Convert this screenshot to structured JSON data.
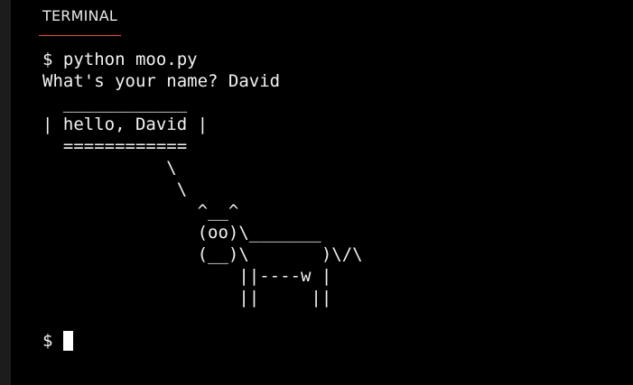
{
  "tabs": [
    {
      "label": "TERMINAL",
      "active": true
    }
  ],
  "accent_color": "#e0563b",
  "terminal": {
    "command_line": "$ python moo.py",
    "name_prompt_line": "What's your name? David",
    "cowsay_art": "  ____________\n| hello, David |\n  ============\n            \\\n             \\\n               ^__^\n               (oo)\\_______\n               (__)\\       )\\/\\\n                   ||----w |\n                   ||     ||",
    "prompt_symbol": "$ "
  }
}
